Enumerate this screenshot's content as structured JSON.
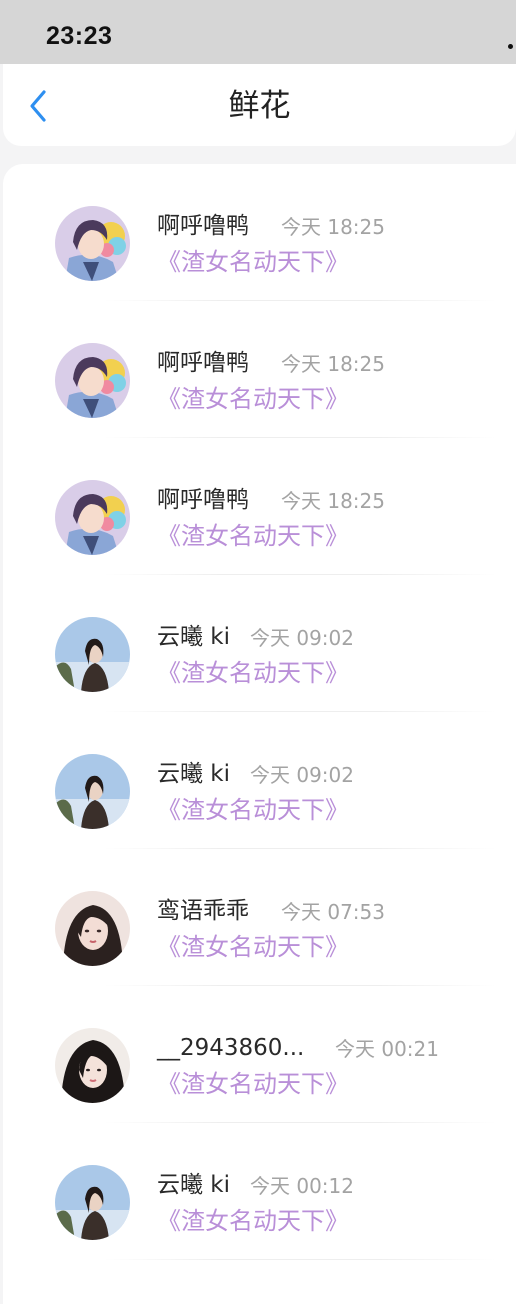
{
  "status_bar": {
    "time": "23:23"
  },
  "nav": {
    "back_icon": "chevron-left-icon",
    "title": "鲜花"
  },
  "colors": {
    "accent": "#2e8ff0",
    "gift_title": "#b98fd8",
    "timestamp": "#a3a3a3"
  },
  "records": [
    {
      "username": "啊呼噜鸭",
      "time": "今天 18:25",
      "title": "《渣女名动天下》",
      "avatar": "anime-boy-avatar"
    },
    {
      "username": "啊呼噜鸭",
      "time": "今天 18:25",
      "title": "《渣女名动天下》",
      "avatar": "anime-boy-avatar"
    },
    {
      "username": "啊呼噜鸭",
      "time": "今天 18:25",
      "title": "《渣女名动天下》",
      "avatar": "anime-boy-avatar"
    },
    {
      "username": "云曦 ki",
      "time": "今天 09:02",
      "title": "《渣女名动天下》",
      "avatar": "woman-blue-sky-avatar"
    },
    {
      "username": "云曦 ki",
      "time": "今天 09:02",
      "title": "《渣女名动天下》",
      "avatar": "woman-blue-sky-avatar"
    },
    {
      "username": "鸾语乖乖",
      "time": "今天 07:53",
      "title": "《渣女名动天下》",
      "avatar": "woman-portrait-avatar"
    },
    {
      "username": "__2943860...",
      "time": "今天 00:21",
      "title": "《渣女名动天下》",
      "avatar": "woman-dark-hair-avatar"
    },
    {
      "username": "云曦 ki",
      "time": "今天 00:12",
      "title": "《渣女名动天下》",
      "avatar": "woman-blue-sky-avatar"
    }
  ]
}
